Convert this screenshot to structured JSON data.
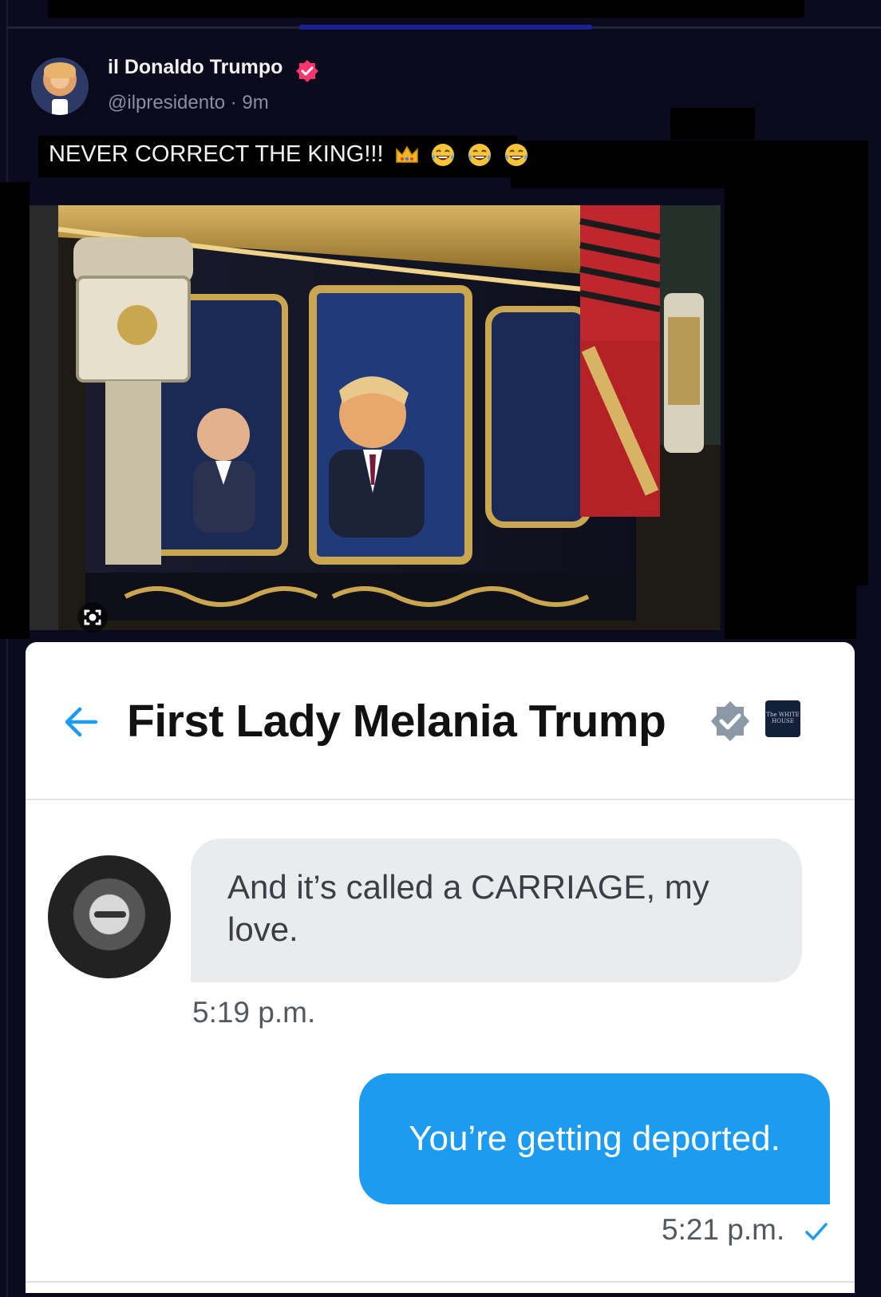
{
  "post": {
    "author": {
      "display_name": "il Donaldo Trumpo",
      "handle_line": "@ilpresidento · 9m",
      "verified": true,
      "verified_color": "#f5376e"
    },
    "caption": {
      "text": "NEVER CORRECT THE KING!!!",
      "emojis": [
        "crown-emoji",
        "tears-of-joy-emoji",
        "tears-of-joy-emoji",
        "tears-of-joy-emoji"
      ]
    },
    "image": {
      "alt_icon": "lens-search-icon"
    }
  },
  "dm": {
    "title": "First Lady Melania Trump",
    "verified_color": "#8b98a5",
    "affiliate_badge": "The WHITE HOUSE",
    "messages": [
      {
        "direction": "received",
        "text": "And it’s called a CARRIAGE, my love.",
        "time": "5:19 p.m."
      },
      {
        "direction": "sent",
        "text": "You’re getting deported.",
        "time": "5:21 p.m.",
        "status": "seen"
      }
    ],
    "accent": "#1d9bf0"
  }
}
